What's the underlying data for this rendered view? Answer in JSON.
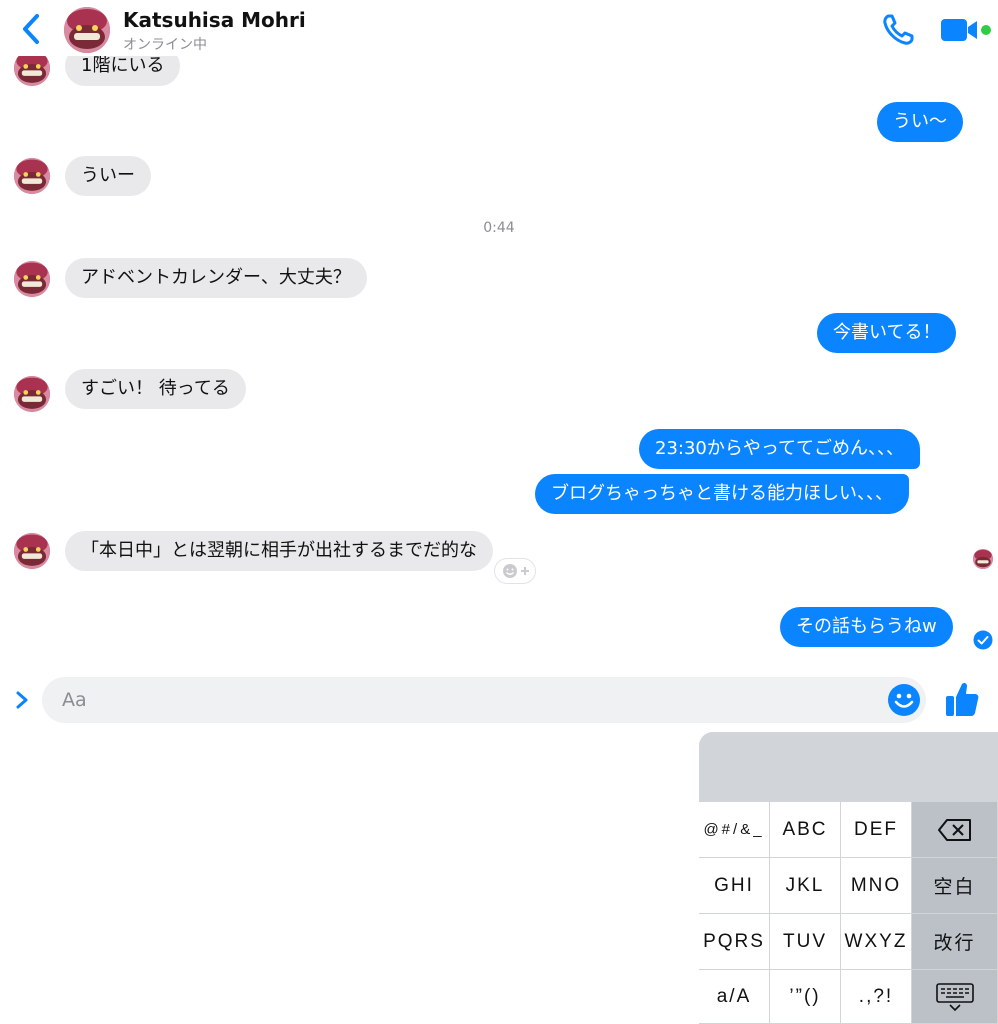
{
  "header": {
    "contact_name": "Katsuhisa Mohri",
    "status": "オンライン中"
  },
  "messages": [
    {
      "side": "incoming",
      "text": "1階にいる"
    },
    {
      "side": "outgoing",
      "text": "うい〜"
    },
    {
      "side": "incoming",
      "text": "ういー"
    },
    {
      "side": "timestamp",
      "text": "0:44"
    },
    {
      "side": "incoming",
      "text": "アドベントカレンダー、大丈夫？"
    },
    {
      "side": "outgoing",
      "text": "今書いてる！"
    },
    {
      "side": "incoming",
      "text": "すごい！ 待ってる"
    },
    {
      "side": "outgoing",
      "text": "23:30からやっててごめん、、、"
    },
    {
      "side": "outgoing",
      "text": "ブログちゃっちゃと書ける能力ほしい、、、"
    },
    {
      "side": "incoming",
      "text": "「本日中」とは翌朝に相手が出社するまでだ的な"
    },
    {
      "side": "outgoing",
      "text": "その話もらうねw"
    }
  ],
  "composer": {
    "placeholder": "Aa"
  },
  "keyboard": {
    "rows": [
      [
        "@#/&_",
        "ABC",
        "DEF",
        "⌫"
      ],
      [
        "GHI",
        "JKL",
        "MNO",
        "空白"
      ],
      [
        "PQRS",
        "TUV",
        "WXYZ",
        "改行"
      ],
      [
        "a/A",
        "’”()",
        ".,?!",
        "keyboard-dismiss"
      ]
    ]
  },
  "colors": {
    "accent": "#0a84ff",
    "incoming_bubble": "#e9e9eb",
    "online": "#31cc46",
    "keyboard_bg": "#d1d4d9"
  }
}
